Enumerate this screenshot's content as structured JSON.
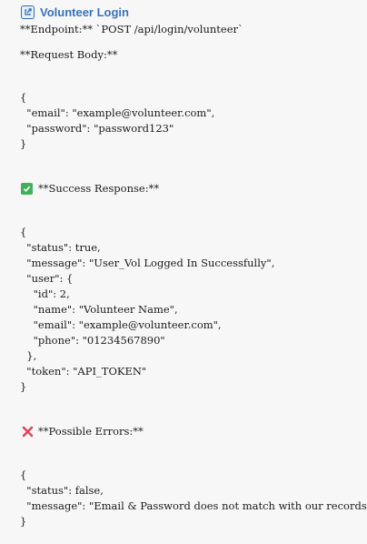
{
  "header": {
    "title": "Volunteer Login",
    "icon": "document-link-icon"
  },
  "endpoint_line": "**Endpoint:** `POST /api/login/volunteer`",
  "request_body_label": "**Request Body:**",
  "request_body": [
    "{",
    "  \"email\": \"example@volunteer.com\",",
    "  \"password\": \"password123\"",
    "}"
  ],
  "success": {
    "icon": "check-mark-icon",
    "label": "**Success Response:**",
    "body": [
      "{",
      "  \"status\": true,",
      "  \"message\": \"User_Vol Logged In Successfully\",",
      "  \"user\": {",
      "    \"id\": 2,",
      "    \"name\": \"Volunteer Name\",",
      "    \"email\": \"example@volunteer.com\",",
      "    \"phone\": \"01234567890\"",
      "  },",
      "  \"token\": \"API_TOKEN\"",
      "}"
    ]
  },
  "errors": {
    "icon": "cross-mark-icon",
    "label": "**Possible Errors:**",
    "body": [
      "{",
      "  \"status\": false,",
      "  \"message\": \"Email & Password does not match with our records.\"",
      "}"
    ]
  },
  "colors": {
    "title": "#3a72b8",
    "check": "#3fb15a",
    "cross": "#e0455c",
    "background": "#f7f7f7"
  }
}
